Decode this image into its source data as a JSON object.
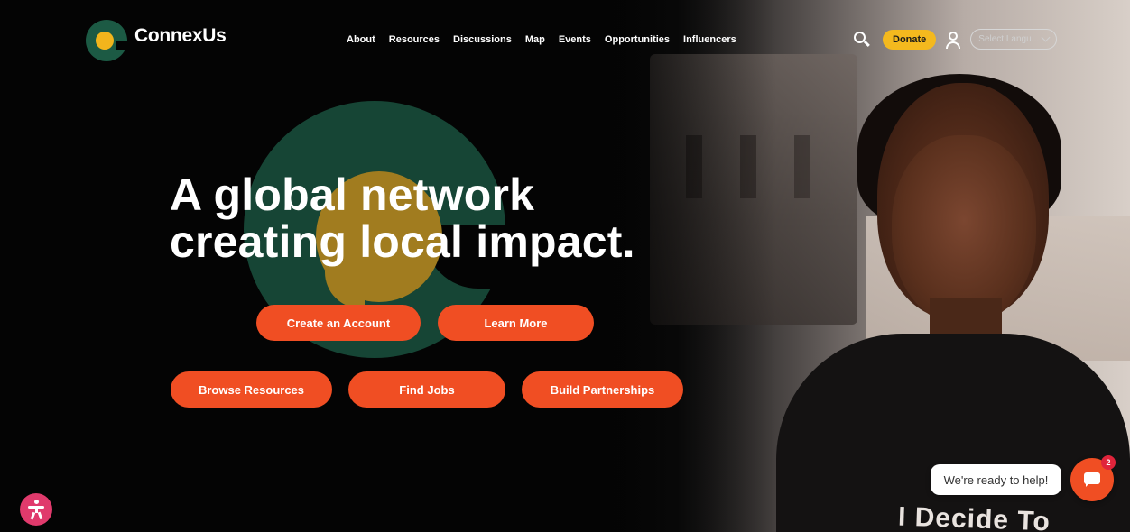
{
  "brand": {
    "name": "ConnexUs"
  },
  "nav": {
    "links": [
      "About",
      "Resources",
      "Discussions",
      "Map",
      "Events",
      "Opportunities",
      "Influencers"
    ],
    "donate_label": "Donate",
    "language_placeholder": "Select Langu...",
    "icons": [
      "search-icon",
      "user-icon",
      "chevron-down-icon"
    ]
  },
  "hero": {
    "headline_line1": "A global network",
    "headline_line2": "creating local impact.",
    "primary_buttons": [
      "Create an Account",
      "Learn More"
    ],
    "secondary_buttons": [
      "Browse Resources",
      "Find Jobs",
      "Build Partnerships"
    ],
    "shirt_text": "I Decide To"
  },
  "chat": {
    "prompt": "We're ready to help!",
    "badge_count": "2"
  },
  "colors": {
    "accent": "#f04e23",
    "donate": "#f4b91e",
    "brand_green": "#1c5a44",
    "accessibility": "#e03a6c",
    "background": "#040404"
  }
}
